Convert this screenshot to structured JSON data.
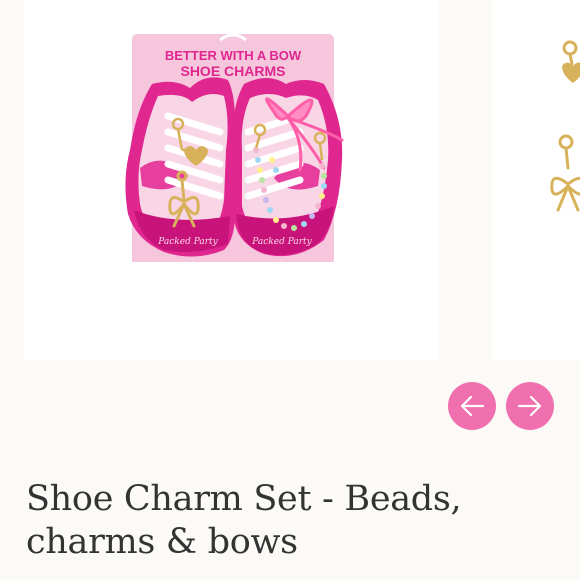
{
  "product": {
    "title": "Shoe Charm Set - Beads, charms & bows",
    "image": {
      "package_headline": "BETTER WITH A BOW",
      "package_subheadline": "SHOE CHARMS",
      "brand_mark": "Packed Party",
      "colors": {
        "card": "#f6c6dc",
        "shoe_magenta": "#e0268f",
        "shoe_light": "#f8d6e6",
        "headline": "#e0268f",
        "ribbon": "#ff5fa8",
        "gold": "#d8b25a"
      }
    }
  },
  "carousel": {
    "prev_icon": "arrow-left-icon",
    "next_icon": "arrow-right-icon",
    "button_color": "#f06fae"
  }
}
